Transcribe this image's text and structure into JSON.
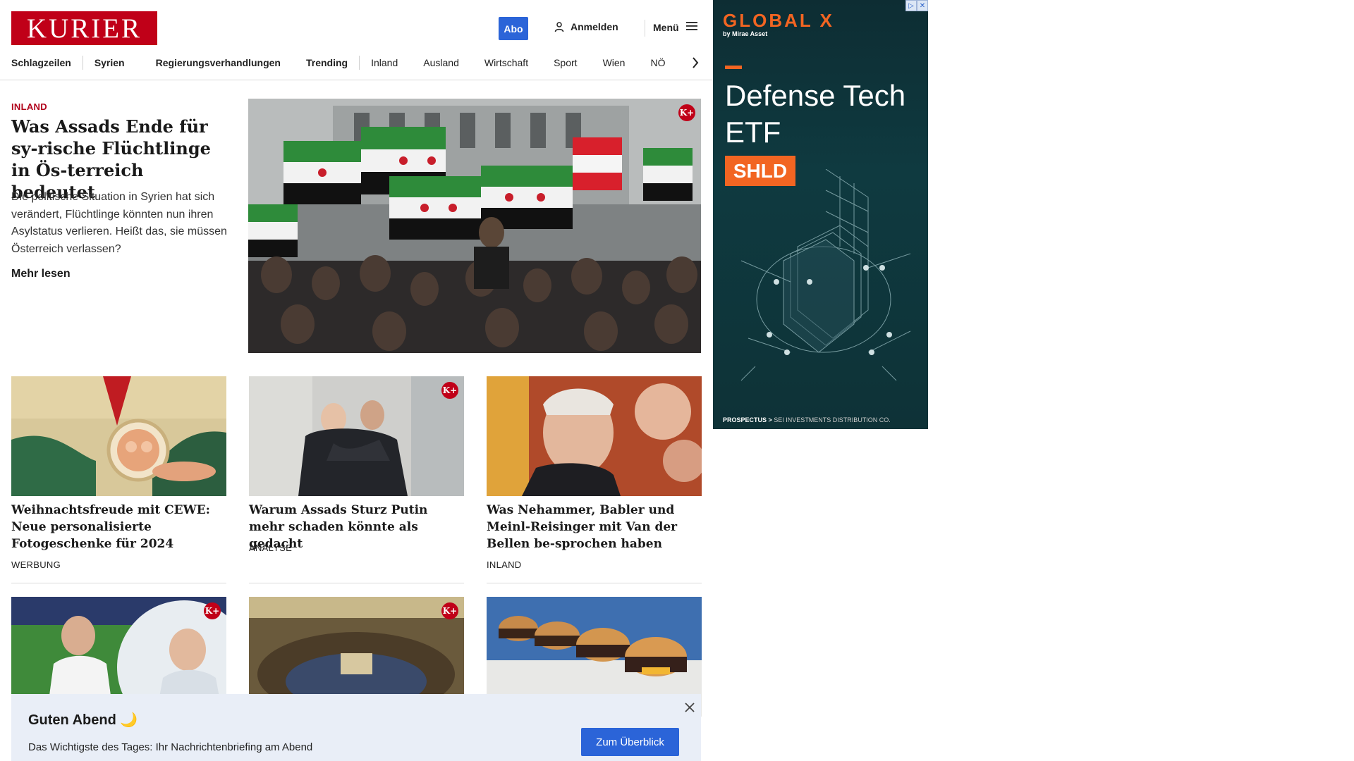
{
  "header": {
    "logo": "KURIER",
    "abo_label": "Abo",
    "login_label": "Anmelden",
    "menu_label": "Menü"
  },
  "nav": {
    "items": [
      "Schlagzeilen",
      "Syrien",
      "Regierungsverhandlungen",
      "Trending",
      "Inland",
      "Ausland",
      "Wirtschaft",
      "Sport",
      "Wien",
      "NÖ"
    ]
  },
  "lead": {
    "kicker": "INLAND",
    "title": "Was Assads Ende für sy-rische Flüchtlinge in Ös-terreich bedeutet",
    "teaser": "Die politische Situation in Syrien hat sich verändert, Flüchtlinge könnten nun ihren Asylstatus verlieren. Heißt das, sie müssen Österreich verlassen?",
    "read_more": "Mehr lesen",
    "premium_badge": "K+"
  },
  "cards": [
    {
      "title": "Weihnachtsfreude mit CEWE: Neue personalisierte Fotogeschenke für 2024",
      "tag": "WERBUNG"
    },
    {
      "title": "Warum Assads Sturz Putin mehr schaden könnte als gedacht",
      "tag": "ANALYSE",
      "premium_badge": "K+"
    },
    {
      "title": "Was Nehammer, Babler und Meinl-Reisinger mit Van der Bellen be-sprochen haben",
      "tag": "INLAND"
    }
  ],
  "cards_row2": [
    {
      "premium_badge": "K+"
    },
    {
      "premium_badge": "K+"
    },
    {}
  ],
  "ad": {
    "brand": "GLOBAL X",
    "brand_sub": "by Mirae Asset",
    "headline": "Defense Tech ETF",
    "ticker": "SHLD",
    "footer_link": "PROSPECTUS >",
    "footer_text": "SEI INVESTMENTS DISTRIBUTION CO."
  },
  "banner": {
    "title": "Guten Abend 🌙",
    "text": "Das Wichtigste des Tages: Ihr Nachrichtenbriefing am Abend",
    "button": "Zum Überblick"
  },
  "colors": {
    "brand_red": "#c00018",
    "accent_blue": "#2b64d8",
    "ad_orange": "#f26522",
    "banner_bg": "#e9eef7"
  }
}
